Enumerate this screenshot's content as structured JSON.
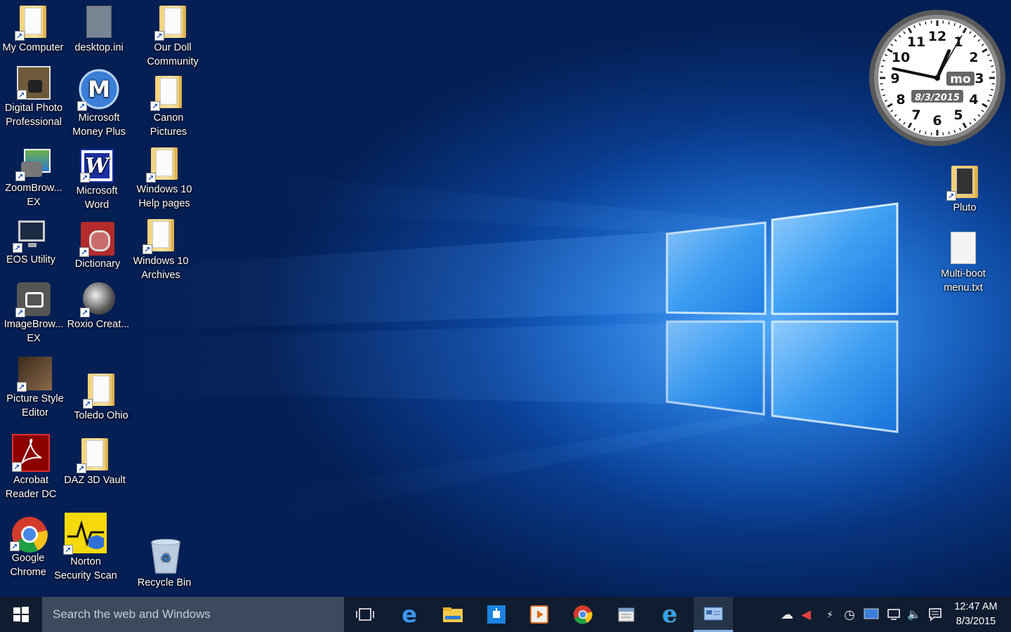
{
  "desktop_icons": [
    {
      "label": "My Computer"
    },
    {
      "label": "desktop.ini"
    },
    {
      "label": "Our Doll Community"
    },
    {
      "label": "Digital Photo Professional"
    },
    {
      "label": "Microsoft Money Plus"
    },
    {
      "label": "Canon Pictures"
    },
    {
      "label": "ZoomBrow... EX"
    },
    {
      "label": "Microsoft Word"
    },
    {
      "label": "Windows 10 Help pages"
    },
    {
      "label": "EOS Utility"
    },
    {
      "label": "Dictionary"
    },
    {
      "label": "Windows 10 Archives"
    },
    {
      "label": "ImageBrow... EX"
    },
    {
      "label": "Roxio Creat..."
    },
    {
      "label": "Picture Style Editor"
    },
    {
      "label": "Toledo Ohio"
    },
    {
      "label": "Acrobat Reader DC"
    },
    {
      "label": "DAZ 3D Vault"
    },
    {
      "label": "Google Chrome"
    },
    {
      "label": "Norton Security Scan"
    },
    {
      "label": "Recycle Bin"
    },
    {
      "label": "Pluto"
    },
    {
      "label": "Multi-boot menu.txt"
    }
  ],
  "clock_gadget": {
    "numbers": [
      "12",
      "1",
      "2",
      "3",
      "4",
      "5",
      "6",
      "7",
      "8",
      "9",
      "10",
      "11"
    ],
    "day": "mo",
    "date": "8/3/2015",
    "hour": 12,
    "minute": 47,
    "second": 5
  },
  "taskbar": {
    "search_placeholder": "Search the web and Windows",
    "pinned": [
      "task-view",
      "edge",
      "file-explorer",
      "store",
      "media-player",
      "chrome",
      "calendar",
      "internet-explorer",
      "control-panel"
    ],
    "time": "12:47 AM",
    "date": "8/3/2015"
  },
  "colors": {
    "taskbar": "#101c30",
    "search_box": "#3c4a5e",
    "wallpaper_glow": "#2f8bf0"
  }
}
